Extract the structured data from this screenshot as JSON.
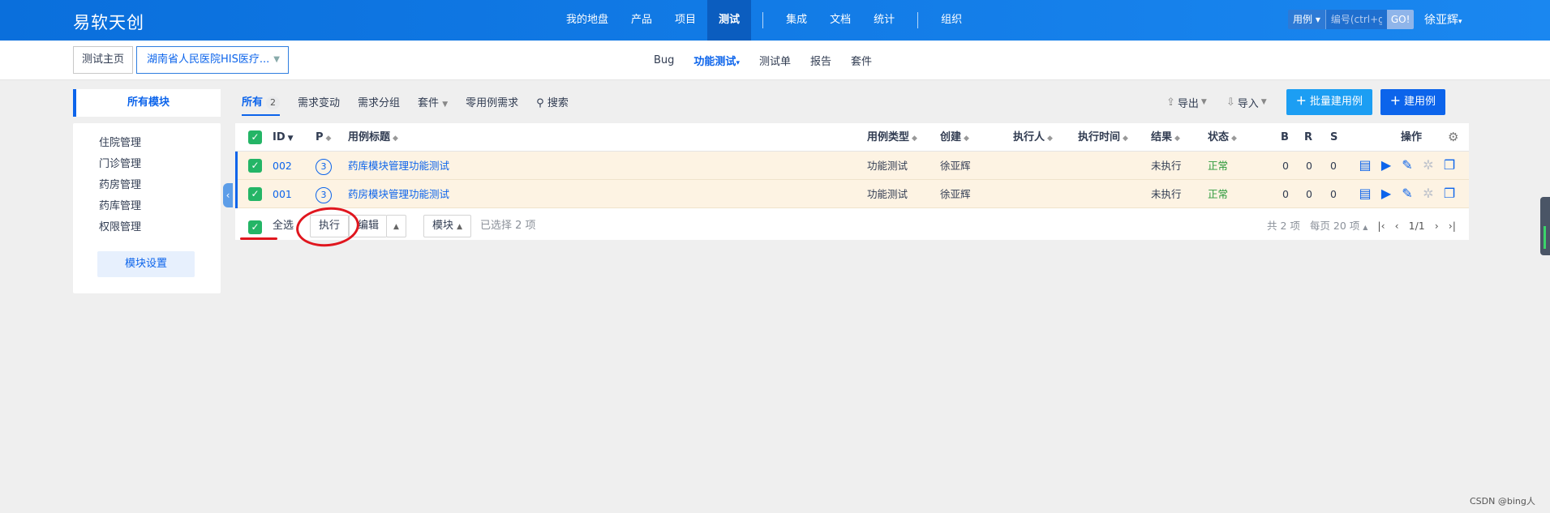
{
  "header": {
    "brand": "易软天创",
    "nav": [
      "我的地盘",
      "产品",
      "项目",
      "测试",
      "集成",
      "文档",
      "统计",
      "组织"
    ],
    "active_nav": "测试",
    "search_type": "用例",
    "search_placeholder": "编号(ctrl+g)",
    "search_go": "GO!",
    "user": "徐亚辉"
  },
  "subbar": {
    "home": "测试主页",
    "project": "湖南省人民医院HIS医疗...",
    "nav": [
      "Bug",
      "功能测试",
      "测试单",
      "报告",
      "套件"
    ],
    "active_nav": "功能测试"
  },
  "sidebar": {
    "head": "所有模块",
    "modules": [
      "住院管理",
      "门诊管理",
      "药房管理",
      "药库管理",
      "权限管理"
    ],
    "settings_button": "模块设置"
  },
  "toolbar": {
    "tabs": [
      "所有",
      "需求变动",
      "需求分组",
      "套件",
      "零用例需求"
    ],
    "all_count": "2",
    "search": "搜索",
    "export": "导出",
    "import": "导入",
    "batch_create": "批量建用例",
    "create": "建用例"
  },
  "table": {
    "columns": {
      "id": "ID",
      "p": "P",
      "title": "用例标题",
      "type": "用例类型",
      "creator": "创建",
      "executor": "执行人",
      "exec_time": "执行时间",
      "result": "结果",
      "status": "状态",
      "b": "B",
      "r": "R",
      "s": "S",
      "ops": "操作"
    },
    "rows": [
      {
        "id": "002",
        "p": "3",
        "title": "药库模块管理功能测试",
        "type": "功能测试",
        "creator": "徐亚辉",
        "result": "未执行",
        "status": "正常",
        "b": "0",
        "r": "0",
        "s": "0"
      },
      {
        "id": "001",
        "p": "3",
        "title": "药房模块管理功能测试",
        "type": "功能测试",
        "creator": "徐亚辉",
        "result": "未执行",
        "status": "正常",
        "b": "0",
        "r": "0",
        "s": "0"
      }
    ]
  },
  "footer": {
    "select_all": "全选",
    "execute": "执行",
    "edit": "编辑",
    "module": "模块",
    "selected": "已选择 2 项",
    "total": "共 2 项",
    "per_page": "每页 20 项",
    "page": "1/1"
  },
  "watermark": "CSDN @bing人",
  "colors": {
    "primary": "#0c64eb",
    "header": "#1a87f0",
    "row_highlight": "#fdf3e3",
    "check": "#24b566",
    "annotation": "#e0161e"
  }
}
